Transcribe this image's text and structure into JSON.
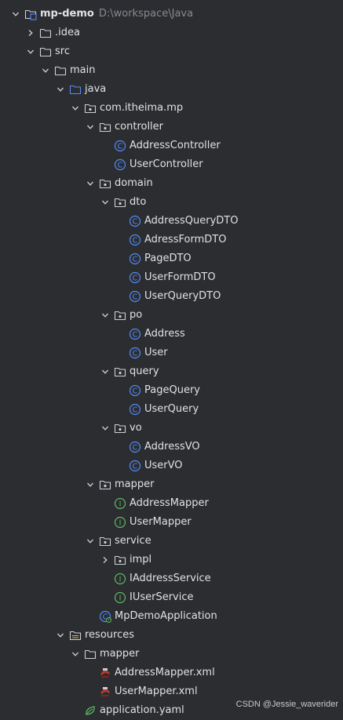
{
  "tree": [
    {
      "label": "mp-demo",
      "path": "D:\\workspace\\Java",
      "icon": "module-folder-icon",
      "depth": 0,
      "chevron": "expanded",
      "bold": true
    },
    {
      "label": ".idea",
      "icon": "folder-icon",
      "depth": 1,
      "chevron": "collapsed"
    },
    {
      "label": "src",
      "icon": "folder-icon",
      "depth": 1,
      "chevron": "expanded"
    },
    {
      "label": "main",
      "icon": "folder-icon",
      "depth": 2,
      "chevron": "expanded"
    },
    {
      "label": "java",
      "icon": "source-folder-icon",
      "depth": 3,
      "chevron": "expanded"
    },
    {
      "label": "com.itheima.mp",
      "icon": "package-icon",
      "depth": 4,
      "chevron": "expanded"
    },
    {
      "label": "controller",
      "icon": "package-icon",
      "depth": 5,
      "chevron": "expanded"
    },
    {
      "label": "AddressController",
      "icon": "class-icon",
      "depth": 6
    },
    {
      "label": "UserController",
      "icon": "class-icon",
      "depth": 6
    },
    {
      "label": "domain",
      "icon": "package-icon",
      "depth": 5,
      "chevron": "expanded"
    },
    {
      "label": "dto",
      "icon": "package-icon",
      "depth": 6,
      "chevron": "expanded"
    },
    {
      "label": "AddressQueryDTO",
      "icon": "class-icon",
      "depth": 7
    },
    {
      "label": "AdressFormDTO",
      "icon": "class-icon",
      "depth": 7
    },
    {
      "label": "PageDTO",
      "icon": "class-icon",
      "depth": 7
    },
    {
      "label": "UserFormDTO",
      "icon": "class-icon",
      "depth": 7
    },
    {
      "label": "UserQueryDTO",
      "icon": "class-icon",
      "depth": 7
    },
    {
      "label": "po",
      "icon": "package-icon",
      "depth": 6,
      "chevron": "expanded"
    },
    {
      "label": "Address",
      "icon": "class-icon",
      "depth": 7
    },
    {
      "label": "User",
      "icon": "class-icon",
      "depth": 7
    },
    {
      "label": "query",
      "icon": "package-icon",
      "depth": 6,
      "chevron": "expanded"
    },
    {
      "label": "PageQuery",
      "icon": "class-icon",
      "depth": 7
    },
    {
      "label": "UserQuery",
      "icon": "class-icon",
      "depth": 7
    },
    {
      "label": "vo",
      "icon": "package-icon",
      "depth": 6,
      "chevron": "expanded"
    },
    {
      "label": "AddressVO",
      "icon": "class-icon",
      "depth": 7
    },
    {
      "label": "UserVO",
      "icon": "class-icon",
      "depth": 7
    },
    {
      "label": "mapper",
      "icon": "package-icon",
      "depth": 5,
      "chevron": "expanded"
    },
    {
      "label": "AddressMapper",
      "icon": "interface-icon",
      "depth": 6
    },
    {
      "label": "UserMapper",
      "icon": "interface-icon",
      "depth": 6
    },
    {
      "label": "service",
      "icon": "package-icon",
      "depth": 5,
      "chevron": "expanded"
    },
    {
      "label": "impl",
      "icon": "package-icon",
      "depth": 6,
      "chevron": "collapsed"
    },
    {
      "label": "IAddressService",
      "icon": "interface-icon",
      "depth": 6
    },
    {
      "label": "IUserService",
      "icon": "interface-icon",
      "depth": 6
    },
    {
      "label": "MpDemoApplication",
      "icon": "spring-boot-class-icon",
      "depth": 5
    },
    {
      "label": "resources",
      "icon": "resources-folder-icon",
      "depth": 3,
      "chevron": "expanded"
    },
    {
      "label": "mapper",
      "icon": "folder-icon",
      "depth": 4,
      "chevron": "expanded"
    },
    {
      "label": "AddressMapper.xml",
      "icon": "mybatis-xml-icon",
      "depth": 5
    },
    {
      "label": "UserMapper.xml",
      "icon": "mybatis-xml-icon",
      "depth": 5
    },
    {
      "label": "application.yaml",
      "icon": "spring-yaml-icon",
      "depth": 4
    }
  ],
  "watermark": "CSDN @Jessie_waverider",
  "colors": {
    "background": "#2b2d30",
    "text": "#dfe1e5",
    "path_text": "#868a91",
    "class_icon": "#548af7",
    "interface_icon": "#5fb865",
    "folder_stroke": "#ced0d6",
    "source_folder": "#548af7"
  }
}
